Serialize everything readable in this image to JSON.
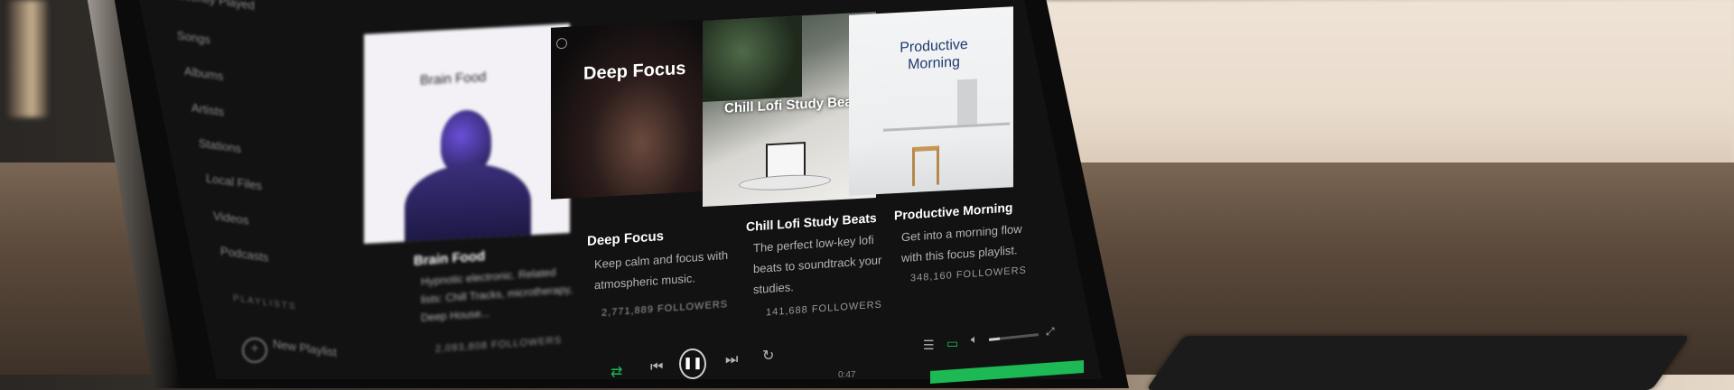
{
  "sidebar": {
    "items": [
      "Recently Played",
      "Songs",
      "Albums",
      "Artists",
      "Stations",
      "Local Files",
      "Videos",
      "Podcasts"
    ],
    "playlists_heading": "PLAYLISTS",
    "new_playlist": "New Playlist"
  },
  "cards": [
    {
      "cover_title": "Brain Food",
      "title": "Brain Food",
      "description": "Hypnotic electronic. Related lists: Chill Tracks, microtherapy, Deep House...",
      "followers": "2,093,808 FOLLOWERS"
    },
    {
      "cover_title": "Deep Focus",
      "title": "Deep Focus",
      "description": "Keep calm and focus with atmospheric music.",
      "followers": "2,771,889 FOLLOWERS"
    },
    {
      "cover_title": "Chill Lofi Study Beats",
      "title": "Chill Lofi Study Beats",
      "description": "The perfect low-key lofi beats to soundtrack your studies.",
      "followers": "141,688 FOLLOWERS"
    },
    {
      "cover_title": "Productive Morning",
      "title": "Productive Morning",
      "description": "Get into a morning flow with this focus playlist.",
      "followers": "348,160 FOLLOWERS"
    }
  ],
  "player": {
    "elapsed": "0:47",
    "volume_level": 0.22,
    "icons": [
      "shuffle-icon",
      "previous-icon",
      "pause-icon",
      "next-icon",
      "repeat-icon",
      "queue-icon",
      "devices-icon",
      "volume-icon",
      "fullscreen-icon"
    ]
  },
  "colors": {
    "background": "#121212",
    "accent_green": "#1db954",
    "text_primary": "#ffffff",
    "text_secondary": "#b3b3b3"
  }
}
